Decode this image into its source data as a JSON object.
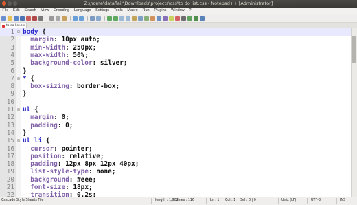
{
  "window": {
    "title": "Z:\\home\\dataflair\\Downloads\\projects\\css\\to do list.css - Notepad++ [Administrator]"
  },
  "menu": [
    "File",
    "Edit",
    "Search",
    "View",
    "Encoding",
    "Language",
    "Settings",
    "Tools",
    "Macro",
    "Run",
    "Plugins",
    "Window",
    "?"
  ],
  "tab": {
    "label": "to do list.css"
  },
  "editor": {
    "lines": [
      {
        "n": "1",
        "fold": "⊟",
        "segs": [
          [
            "sel",
            "body"
          ],
          [
            "punc",
            " {"
          ]
        ],
        "current": true
      },
      {
        "n": "2",
        "segs": [
          [
            "prop",
            "  margin"
          ],
          [
            "punc",
            ": "
          ],
          [
            "val",
            "10px auto"
          ],
          [
            "punc",
            ";"
          ]
        ]
      },
      {
        "n": "3",
        "segs": [
          [
            "prop",
            "  min-width"
          ],
          [
            "punc",
            ": "
          ],
          [
            "val",
            "250px"
          ],
          [
            "punc",
            ";"
          ]
        ]
      },
      {
        "n": "4",
        "segs": [
          [
            "prop",
            "  max-width"
          ],
          [
            "punc",
            ": "
          ],
          [
            "val",
            "50%"
          ],
          [
            "punc",
            ";"
          ]
        ]
      },
      {
        "n": "5",
        "segs": [
          [
            "prop",
            "  background-color"
          ],
          [
            "punc",
            ": "
          ],
          [
            "val",
            "silver"
          ],
          [
            "punc",
            ";"
          ]
        ]
      },
      {
        "n": "6",
        "segs": [
          [
            "punc",
            "}"
          ]
        ]
      },
      {
        "n": "7",
        "fold": "⊟",
        "segs": [
          [
            "sel",
            "*"
          ],
          [
            "punc",
            " {"
          ]
        ]
      },
      {
        "n": "8",
        "segs": [
          [
            "prop",
            "  box-sizing"
          ],
          [
            "punc",
            ": "
          ],
          [
            "val",
            "border-box"
          ],
          [
            "punc",
            ";"
          ]
        ]
      },
      {
        "n": "9",
        "segs": [
          [
            "punc",
            "}"
          ]
        ]
      },
      {
        "n": "10",
        "segs": []
      },
      {
        "n": "11",
        "fold": "⊟",
        "segs": [
          [
            "sel",
            "ul"
          ],
          [
            "punc",
            " {"
          ]
        ]
      },
      {
        "n": "12",
        "segs": [
          [
            "prop",
            "  margin"
          ],
          [
            "punc",
            ": "
          ],
          [
            "val",
            "0"
          ],
          [
            "punc",
            ";"
          ]
        ]
      },
      {
        "n": "13",
        "segs": [
          [
            "prop",
            "  padding"
          ],
          [
            "punc",
            ": "
          ],
          [
            "val",
            "0"
          ],
          [
            "punc",
            ";"
          ]
        ]
      },
      {
        "n": "14",
        "segs": [
          [
            "punc",
            "}"
          ]
        ]
      },
      {
        "n": "15",
        "fold": "⊟",
        "segs": [
          [
            "sel",
            "ul li"
          ],
          [
            "punc",
            " {"
          ]
        ]
      },
      {
        "n": "16",
        "segs": [
          [
            "prop",
            "  cursor"
          ],
          [
            "punc",
            ": "
          ],
          [
            "val",
            "pointer"
          ],
          [
            "punc",
            ";"
          ]
        ]
      },
      {
        "n": "17",
        "segs": [
          [
            "prop",
            "  position"
          ],
          [
            "punc",
            ": "
          ],
          [
            "val",
            "relative"
          ],
          [
            "punc",
            ";"
          ]
        ]
      },
      {
        "n": "18",
        "segs": [
          [
            "prop",
            "  padding"
          ],
          [
            "punc",
            ": "
          ],
          [
            "val",
            "12px 8px 12px 40px"
          ],
          [
            "punc",
            ";"
          ]
        ]
      },
      {
        "n": "19",
        "segs": [
          [
            "prop",
            "  list-style-type"
          ],
          [
            "punc",
            ": "
          ],
          [
            "val",
            "none"
          ],
          [
            "punc",
            ";"
          ]
        ]
      },
      {
        "n": "20",
        "segs": [
          [
            "prop",
            "  background"
          ],
          [
            "punc",
            ": "
          ],
          [
            "val",
            "#eee"
          ],
          [
            "punc",
            ";"
          ]
        ]
      },
      {
        "n": "21",
        "segs": [
          [
            "prop",
            "  font-size"
          ],
          [
            "punc",
            ": "
          ],
          [
            "val",
            "18px"
          ],
          [
            "punc",
            ";"
          ]
        ]
      },
      {
        "n": "22",
        "segs": [
          [
            "prop",
            "  transition"
          ],
          [
            "punc",
            ": "
          ],
          [
            "val",
            "0.2s"
          ],
          [
            "punc",
            ";"
          ]
        ]
      }
    ]
  },
  "status": {
    "filetype": "Cascade Style Sheets File",
    "length": "length : 1,902",
    "lines": "lines : 116",
    "ln": "Ln : 1",
    "col": "Col : 1",
    "sel": "Sel : 0 | 0",
    "eol": "Unix (LF)",
    "encoding": "UTF-8",
    "mode": "INS"
  },
  "colors": {
    "selector": "#2b2bcc",
    "property": "#8060a8",
    "value": "#111111"
  }
}
